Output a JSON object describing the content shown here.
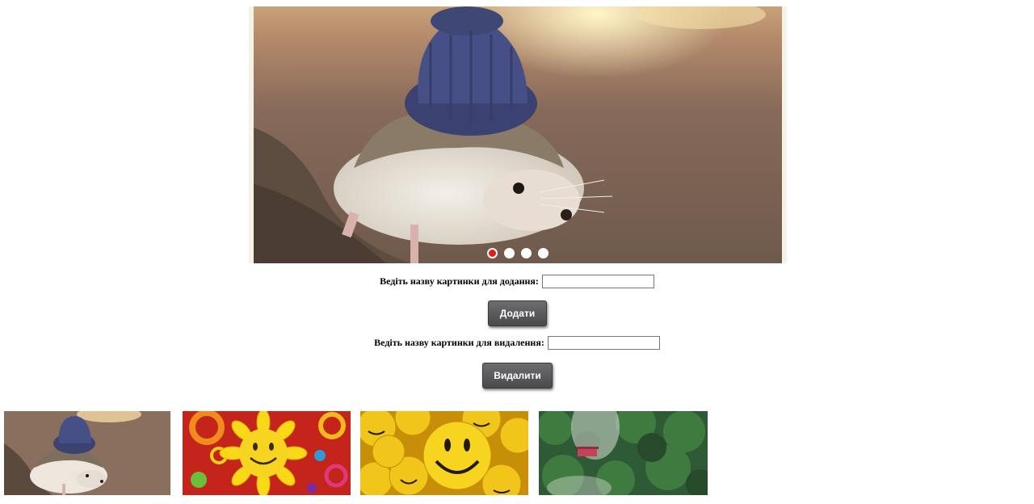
{
  "slider": {
    "slides": [
      {
        "icon": "hedgehog-with-blue-hat-image"
      },
      {
        "icon": "sunflower-smiley-image"
      },
      {
        "icon": "yellow-smiley-balls-image"
      },
      {
        "icon": "forest-image"
      }
    ],
    "active_index": 0,
    "colors": {
      "active_dot": "#e21b1b",
      "dot": "#ffffff"
    }
  },
  "add_form": {
    "label": "Ведіть назву картинки для додання:",
    "value": "",
    "button_label": "Додати"
  },
  "delete_form": {
    "label": "Ведіть назву картинки для видалення:",
    "value": "",
    "button_label": "Видалити"
  },
  "thumbnails": [
    {
      "icon": "hedgehog-thumbnail"
    },
    {
      "icon": "sunflower-smiley-thumbnail"
    },
    {
      "icon": "yellow-smileys-thumbnail"
    },
    {
      "icon": "forest-thumbnail"
    }
  ]
}
